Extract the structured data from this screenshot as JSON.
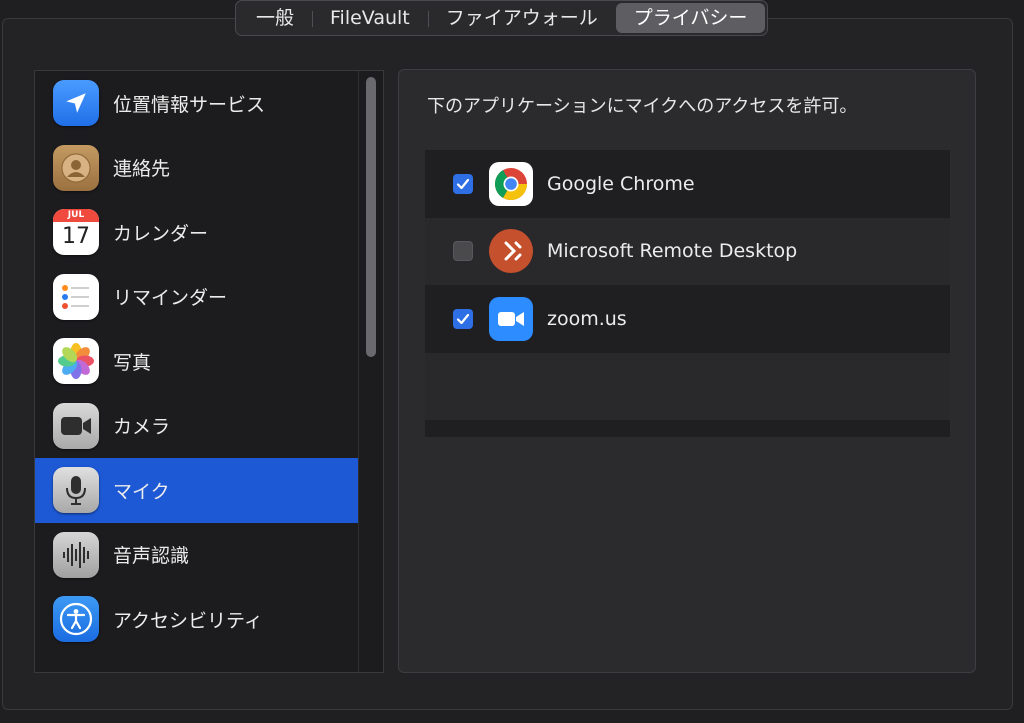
{
  "tabs": [
    {
      "label": "一般",
      "active": false
    },
    {
      "label": "FileVault",
      "active": false
    },
    {
      "label": "ファイアウォール",
      "active": false
    },
    {
      "label": "プライバシー",
      "active": true
    }
  ],
  "sidebar": {
    "items": [
      {
        "label": "位置情報サービス",
        "icon": "location-arrow-icon",
        "selected": false
      },
      {
        "label": "連絡先",
        "icon": "contacts-icon",
        "selected": false
      },
      {
        "label": "カレンダー",
        "icon": "calendar-icon",
        "selected": false,
        "month": "JUL",
        "day": "17"
      },
      {
        "label": "リマインダー",
        "icon": "reminders-icon",
        "selected": false
      },
      {
        "label": "写真",
        "icon": "photos-icon",
        "selected": false
      },
      {
        "label": "カメラ",
        "icon": "camera-icon",
        "selected": false
      },
      {
        "label": "マイク",
        "icon": "microphone-icon",
        "selected": true
      },
      {
        "label": "音声認識",
        "icon": "speech-recognition-icon",
        "selected": false
      },
      {
        "label": "アクセシビリティ",
        "icon": "accessibility-icon",
        "selected": false
      }
    ]
  },
  "panel": {
    "description": "下のアプリケーションにマイクへのアクセスを許可。",
    "apps": [
      {
        "name": "Google Chrome",
        "checked": true,
        "icon": "chrome-icon"
      },
      {
        "name": "Microsoft Remote Desktop",
        "checked": false,
        "icon": "remote-desktop-icon"
      },
      {
        "name": "zoom.us",
        "checked": true,
        "icon": "zoom-icon"
      }
    ]
  },
  "colors": {
    "selection": "#1d58d5",
    "checkbox_on": "#2f6fe6",
    "background": "#1f1e21"
  }
}
